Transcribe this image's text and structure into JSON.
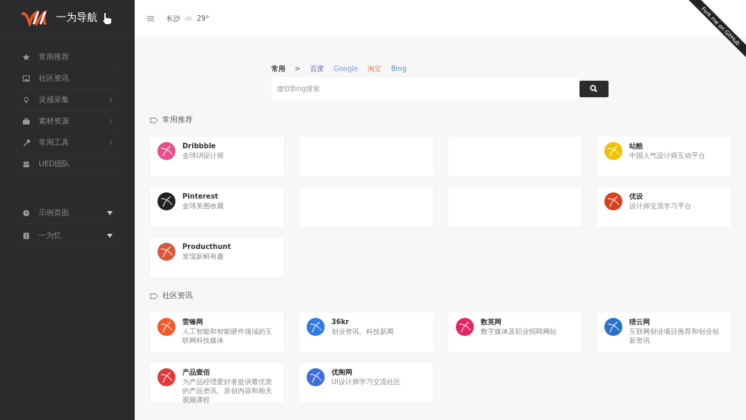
{
  "sidebar": {
    "logo": "一为导航",
    "items": [
      {
        "label": "常用推荐",
        "kind": "plain"
      },
      {
        "label": "社区资讯",
        "kind": "plain"
      },
      {
        "label": "灵感采集",
        "kind": "submenu"
      },
      {
        "label": "素材资源",
        "kind": "submenu"
      },
      {
        "label": "常用工具",
        "kind": "submenu"
      },
      {
        "label": "UED团队",
        "kind": "plain"
      }
    ],
    "bottom_items": [
      {
        "label": "示例页面",
        "kind": "dropdown"
      },
      {
        "label": "一为忆",
        "kind": "dropdown"
      }
    ]
  },
  "header": {
    "city": "长沙",
    "temperature": "29°",
    "ribbon": "Fork me on GitHub"
  },
  "search": {
    "group": "常用",
    "separator": ">",
    "engines": [
      {
        "label": "百度"
      },
      {
        "label": "Google"
      },
      {
        "label": "淘宝"
      },
      {
        "label": "Bing"
      }
    ],
    "placeholder": "微软Bing搜索"
  },
  "sections": [
    {
      "title": "常用推荐",
      "cards": [
        {
          "kind": "site",
          "name": "Dribbble",
          "desc": "全球UI设计师"
        },
        {
          "kind": "covered"
        },
        {
          "kind": "covered"
        },
        {
          "kind": "site",
          "name": "站酷",
          "desc": "中国人气设计师互动平台"
        },
        {
          "kind": "site",
          "name": "Pinterest",
          "desc": "全球美图收藏"
        },
        {
          "kind": "covered"
        },
        {
          "kind": "covered"
        },
        {
          "kind": "site",
          "name": "优设",
          "desc": "设计师交流学习平台"
        },
        {
          "kind": "site",
          "name": "Producthunt",
          "desc": "发现新鲜有趣"
        }
      ]
    },
    {
      "title": "社区资讯",
      "cards": [
        {
          "kind": "site",
          "name": "雷锋网",
          "desc": "人工智能和智能硬件领域的互联网科技媒体"
        },
        {
          "kind": "site",
          "name": "36kr",
          "desc": "创业资讯、科技新闻"
        },
        {
          "kind": "site",
          "name": "数英网",
          "desc": "数字媒体及职业招聘网站"
        },
        {
          "kind": "site",
          "name": "猎云网",
          "desc": "互联网创业项目推荐和创业创新资讯"
        },
        {
          "kind": "site",
          "name": "产品壹佰",
          "desc": "为产品经理爱好者提供最优质的产品资讯、原创内容和相关视频课程"
        },
        {
          "kind": "site",
          "name": "优阁网",
          "desc": "UI设计师学习交流社区"
        }
      ]
    }
  ]
}
